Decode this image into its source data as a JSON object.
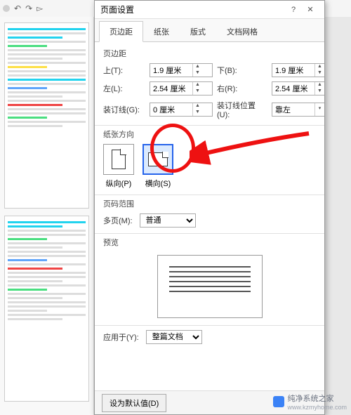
{
  "dialog": {
    "title": "页面设置",
    "help": "?",
    "close": "✕",
    "tabs": [
      "页边距",
      "纸张",
      "版式",
      "文档网格"
    ],
    "margins": {
      "heading": "页边距",
      "top_label": "上(T):",
      "top": "1.9 厘米",
      "bottom_label": "下(B):",
      "bottom": "1.9 厘米",
      "left_label": "左(L):",
      "left": "2.54 厘米",
      "right_label": "右(R):",
      "right": "2.54 厘米",
      "gutter_label": "装订线(G):",
      "gutter": "0 厘米",
      "gutter_pos_label": "装订线位置(U):",
      "gutter_pos": "靠左"
    },
    "orientation": {
      "heading": "纸张方向",
      "portrait": "纵向(P)",
      "landscape": "横向(S)"
    },
    "pages": {
      "heading": "页码范围",
      "multi_label": "多页(M):",
      "multi_value": "普通"
    },
    "preview": {
      "heading": "预览"
    },
    "apply": {
      "label": "应用于(Y):",
      "value": "整篇文档"
    },
    "default_btn": "设为默认值(D)"
  },
  "watermark": {
    "text": "纯净系统之家",
    "url": "www.kzmyhome.com"
  }
}
